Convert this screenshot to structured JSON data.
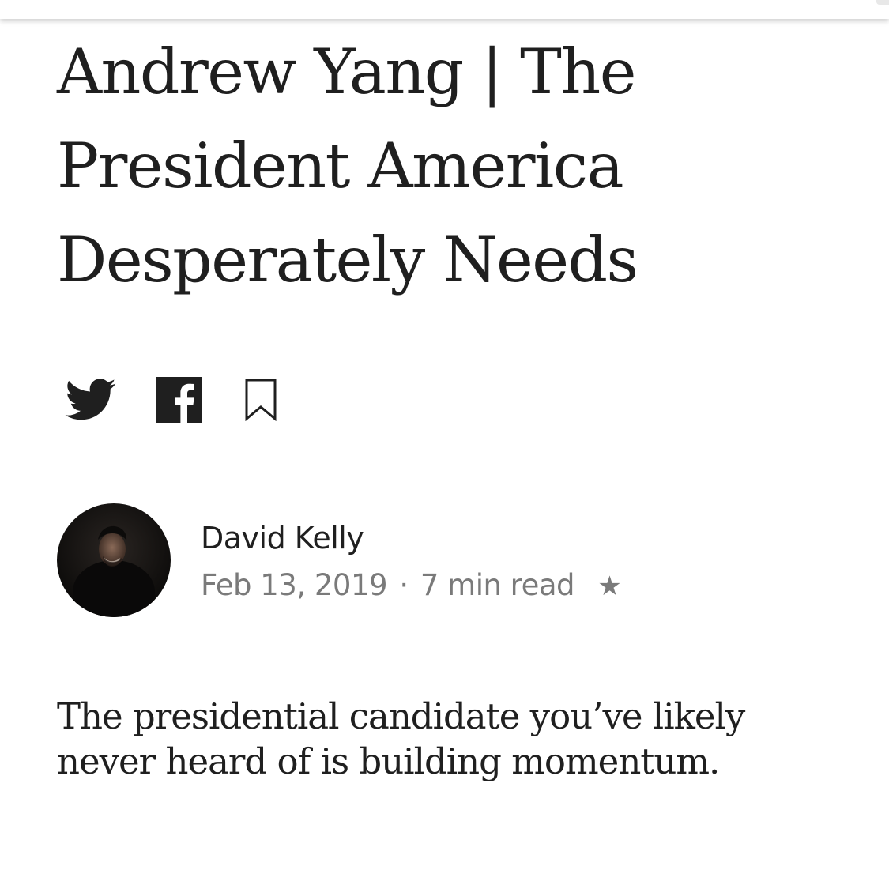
{
  "article": {
    "title": "Andrew Yang | The President America Desperately Needs",
    "subtitle": "The presidential candidate you’ve likely never heard of is building momentum."
  },
  "share": {
    "twitter_icon": "twitter-icon",
    "facebook_icon": "facebook-icon",
    "bookmark_icon": "bookmark-icon"
  },
  "author": {
    "name": "David Kelly",
    "date": "Feb 13, 2019",
    "separator": "·",
    "read_time": "7 min read",
    "member_star": "★"
  },
  "colors": {
    "text": "#1f1f1f",
    "muted": "#7a7a7a",
    "icon": "#1f1f1f",
    "background": "#ffffff"
  }
}
